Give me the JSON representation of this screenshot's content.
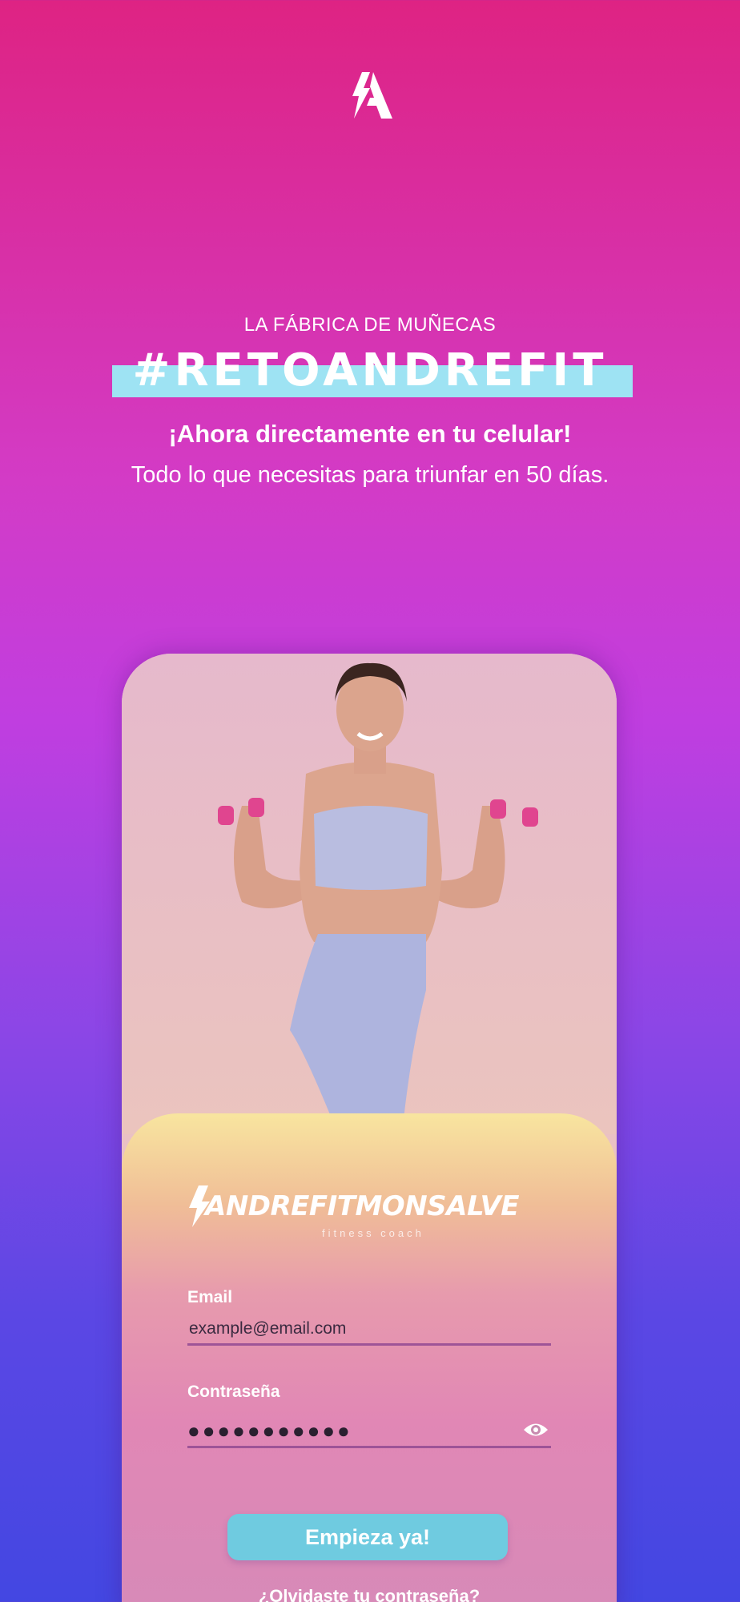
{
  "header": {
    "kicker": "LA FÁBRICA DE MUÑECAS",
    "hashtag": "#RETOANDREFIT",
    "headline": "¡Ahora directamente en tu celular!",
    "subline": "Todo lo que necesitas para triunfar en 50 días."
  },
  "login": {
    "brand_name": "ANDREFITMONSALVE",
    "brand_tagline": "fitness coach",
    "email_label": "Email",
    "email_value": "example@email.com",
    "password_label": "Contraseña",
    "password_value": "●●●●●●●●●●●",
    "submit_label": "Empieza ya!",
    "forgot_label": "¿Olvidaste tu contraseña?"
  },
  "icons": {
    "top_logo": "andrefit-bolt-logo-icon",
    "password_toggle": "eye-icon"
  },
  "colors": {
    "accent_bar": "#9ee3f3",
    "button": "#6fcbe0",
    "underline": "#9e5497"
  }
}
